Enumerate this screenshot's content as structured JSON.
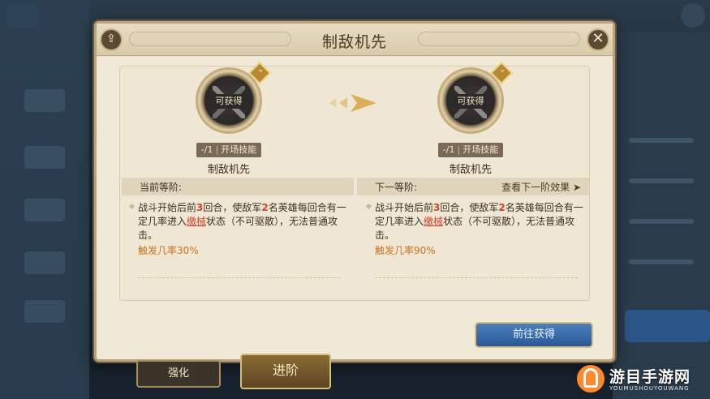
{
  "dialog": {
    "title": "制敌机先",
    "share_icon": "share-icon",
    "close_icon": "close-icon",
    "close_glyph": "✕",
    "share_glyph": "⇪"
  },
  "current_skill": {
    "obtain_label": "可获得",
    "level": "-/1",
    "type": "开场技能",
    "name": "制敌机先"
  },
  "next_skill": {
    "obtain_label": "可获得",
    "level": "-/1",
    "type": "开场技能",
    "name": "制敌机先"
  },
  "current_level": {
    "header": "当前等阶:",
    "desc_p1": "战斗开始后前",
    "desc_n1": "3",
    "desc_p2": "回合，使敌军",
    "desc_n2": "2",
    "desc_p3": "名英雄每回合有一定几率进入",
    "desc_status": "缴械",
    "desc_p4": "状态（不可驱散），无法普通攻击。",
    "rate": "触发几率30%"
  },
  "next_level": {
    "header": "下一等阶:",
    "view_more": "查看下一阶效果",
    "view_more_glyph": "➤",
    "desc_p1": "战斗开始后前",
    "desc_n1": "3",
    "desc_p2": "回合，使敌军",
    "desc_n2": "2",
    "desc_p3": "名英雄每回合有一定几率进入",
    "desc_status": "缴械",
    "desc_p4": "状态（不可驱散），无法普通攻击。",
    "rate": "触发几率90%"
  },
  "actions": {
    "go_obtain": "前往获得"
  },
  "bottom_tabs": {
    "strengthen": "强化",
    "advance": "进阶"
  },
  "watermark": {
    "name": "游目手游网",
    "sub": "YOUMUSHOUYOUWANG"
  },
  "colors": {
    "accent_red": "#d0452b",
    "rate_orange": "#c9731f",
    "button_blue": "#2a5896",
    "parchment": "#f1e9d8"
  }
}
